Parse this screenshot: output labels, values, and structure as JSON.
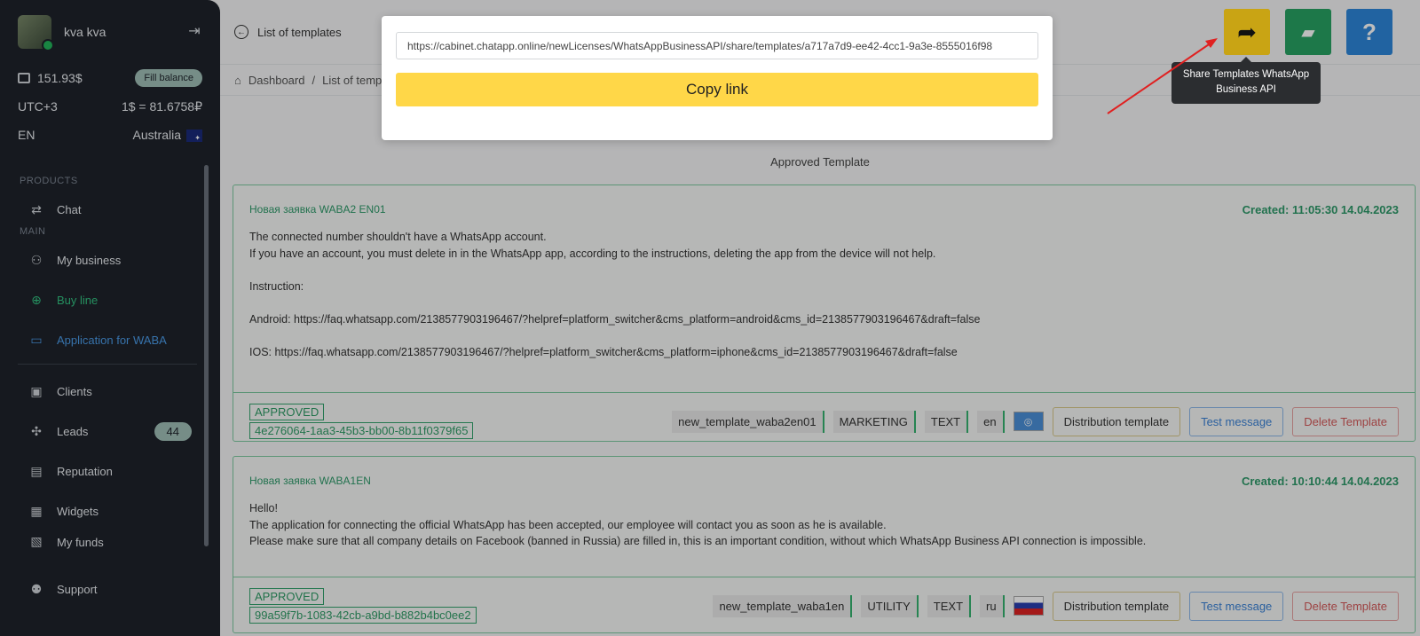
{
  "sidebar": {
    "username": "kva kva",
    "balance": "151.93$",
    "fill_balance": "Fill balance",
    "timezone": "UTC+3",
    "rate": "1$ = 81.6758₽",
    "language": "EN",
    "country": "Australia",
    "products_label": "PRODUCTS",
    "main_label": "MAIN",
    "items": {
      "chat": "Chat",
      "my_business": "My business",
      "buy_line": "Buy line",
      "application_waba": "Application for WABA",
      "clients": "Clients",
      "leads": "Leads",
      "leads_count": "44",
      "reputation": "Reputation",
      "widgets": "Widgets",
      "my_funds": "My funds",
      "support": "Support"
    }
  },
  "header": {
    "back_label": "List of templates",
    "breadcrumb_home": "Dashboard",
    "breadcrumb_current": "List of templates"
  },
  "section_title": "Approved Template",
  "cards": [
    {
      "title": "Новая заявка WABA2 EN01",
      "created": "Created: 11:05:30 14.04.2023",
      "lines": [
        "The connected number shouldn't have a WhatsApp account.",
        "If you have an account, you must delete in in the WhatsApp app, according to the instructions, deleting the app from the device will not help.",
        "",
        "Instruction:",
        "",
        "Android: https://faq.whatsapp.com/2138577903196467/?helpref=platform_switcher&cms_platform=android&cms_id=2138577903196467&draft=false",
        "",
        "IOS: https://faq.whatsapp.com/2138577903196467/?helpref=platform_switcher&cms_platform=iphone&cms_id=2138577903196467&draft=false"
      ],
      "status": "APPROVED",
      "id": "4e276064-1aa3-45b3-bb00-8b11f0379f65",
      "name": "new_template_waba2en01",
      "category": "MARKETING",
      "format": "TEXT",
      "lang": "en"
    },
    {
      "title": "Новая заявка WABA1EN",
      "created": "Created: 10:10:44 14.04.2023",
      "lines": [
        "Hello!",
        "The application for connecting the official WhatsApp has been accepted, our employee will contact you as soon as he is available.",
        "Please make sure that all company details on Facebook (banned in Russia) are filled in, this is an important condition, without which WhatsApp Business API connection is impossible."
      ],
      "status": "APPROVED",
      "id": "99a59f7b-1083-42cb-a9bd-b882b4bc0ee2",
      "name": "new_template_waba1en",
      "category": "UTILITY",
      "format": "TEXT",
      "lang": "ru"
    }
  ],
  "actions": {
    "distribution": "Distribution template",
    "test": "Test message",
    "delete": "Delete Template"
  },
  "modal": {
    "link": "https://cabinet.chatapp.online/newLicenses/WhatsAppBusinessAPI/share/templates/a717a7d9-ee42-4cc1-9a3e-8555016f98",
    "copy_label": "Copy link"
  },
  "tooltip": "Share Templates WhatsApp Business API",
  "colors": {
    "share_button": "#f0c419",
    "add_button": "#28a263",
    "help_button": "#2d86d9",
    "accent_green": "#2e9a6a"
  }
}
